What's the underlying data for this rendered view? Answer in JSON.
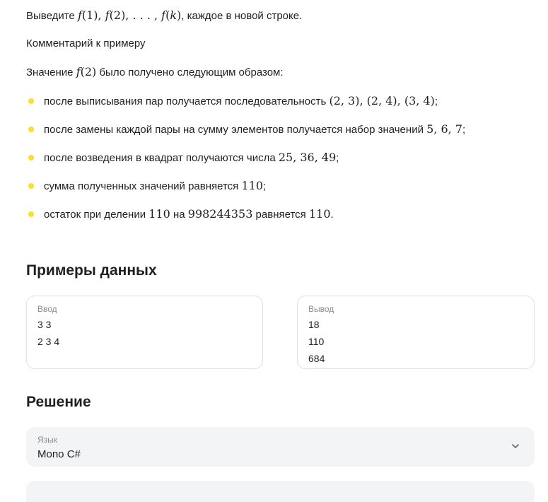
{
  "statement": {
    "output_line": {
      "prefix": "Выведите ",
      "math": [
        "f",
        "(1), ",
        "f",
        "(2), . . . , ",
        "f",
        "(",
        "k",
        ")"
      ],
      "suffix": ", каждое в новой строке."
    },
    "comment_heading": "Комментарий к примеру",
    "value_line": {
      "prefix": "Значение ",
      "math_fn": "f",
      "math_arg": "(2)",
      "suffix": " было получено следующим образом:"
    },
    "bullets": [
      {
        "text": "после выписывания пар получается последовательность ",
        "math": "(2, 3), (2, 4), (3, 4)",
        "tail": ";"
      },
      {
        "text": "после замены каждой пары на сумму элементов получается набор значений ",
        "math": "5, 6, 7",
        "tail": ";"
      },
      {
        "text": "после возведения в квадрат получаются числа ",
        "math": "25, 36, 49",
        "tail": ";"
      },
      {
        "text": "сумма полученных значений равняется ",
        "math": "110",
        "tail": ";"
      },
      {
        "text": "остаток при делении ",
        "math": "110",
        "mid": " на ",
        "math2": "998244353",
        "mid2": " равняется ",
        "math3": "110",
        "tail": "."
      }
    ]
  },
  "examples": {
    "heading": "Примеры данных",
    "input": {
      "label": "Ввод",
      "lines": [
        "3 3",
        "2 3 4"
      ]
    },
    "output": {
      "label": "Вывод",
      "lines": [
        "18",
        "110",
        "684"
      ]
    }
  },
  "solution": {
    "heading": "Решение",
    "language_select": {
      "label": "Язык",
      "value": "Mono C#",
      "icon": "chevron-down-icon"
    }
  },
  "colors": {
    "bullet": "#ffdd2d",
    "field_bg": "#f3f4f6",
    "border": "#dfe1e5"
  }
}
